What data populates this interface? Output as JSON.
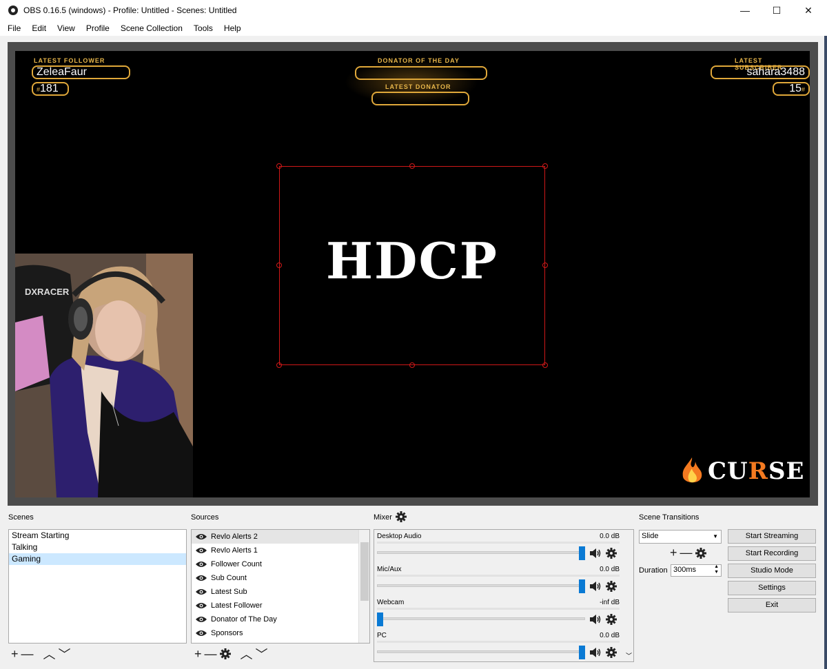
{
  "window": {
    "title": "OBS 0.16.5 (windows) - Profile: Untitled - Scenes: Untitled",
    "min_glyph": "—",
    "max_glyph": "☐",
    "close_glyph": "✕"
  },
  "menu": [
    "File",
    "Edit",
    "View",
    "Profile",
    "Scene Collection",
    "Tools",
    "Help"
  ],
  "preview": {
    "latest_follower_label": "LATEST FOLLOWER",
    "latest_follower": "ZeleaFaur",
    "follower_count_hash": "#",
    "follower_count": "181",
    "donator_label": "DONATOR OF THE DAY",
    "donator_value": "",
    "latest_donator_label": "LATEST DONATOR",
    "latest_donator_value": "",
    "latest_subscriber_label": "LATEST SUBSCRIBER",
    "latest_subscriber": "sahara3488",
    "sub_count": "15",
    "sub_count_hash": "#",
    "hdcp_text": "HDCP",
    "curse_pre": "CU",
    "curse_r": "R",
    "curse_post": "SE",
    "chair_text": "DXRACER"
  },
  "scenes": {
    "title": "Scenes",
    "items": [
      "Stream Starting",
      "Talking",
      "Gaming"
    ],
    "selected_index": 2,
    "toolbar": {
      "add": "+",
      "remove": "—",
      "up": "︿",
      "down": "﹀"
    }
  },
  "sources": {
    "title": "Sources",
    "items": [
      "Revlo Alerts 2",
      "Revlo Alerts 1",
      "Follower Count",
      "Sub Count",
      "Latest Sub",
      "Latest Follower",
      "Donator of The Day",
      "Sponsors"
    ],
    "selected_index": 0,
    "toolbar": {
      "add": "+",
      "remove": "—",
      "up": "︿",
      "down": "﹀"
    }
  },
  "mixer": {
    "title": "Mixer",
    "channels": [
      {
        "name": "Desktop Audio",
        "db": "0.0 dB",
        "level": 1.0
      },
      {
        "name": "Mic/Aux",
        "db": "0.0 dB",
        "level": 1.0
      },
      {
        "name": "Webcam",
        "db": "-inf dB",
        "level": 0.0
      },
      {
        "name": "PC",
        "db": "0.0 dB",
        "level": 1.0
      }
    ]
  },
  "transitions": {
    "title": "Scene Transitions",
    "selected": "Slide",
    "duration_label": "Duration",
    "duration_value": "300ms",
    "add": "+",
    "remove": "—"
  },
  "controls": {
    "start_streaming": "Start Streaming",
    "start_recording": "Start Recording",
    "studio_mode": "Studio Mode",
    "settings": "Settings",
    "exit": "Exit"
  },
  "colors": {
    "accent_gold": "#e0a83a",
    "selection_red": "#d01818",
    "volume_blue": "#0a7ad4",
    "curse_orange": "#f47a20"
  }
}
